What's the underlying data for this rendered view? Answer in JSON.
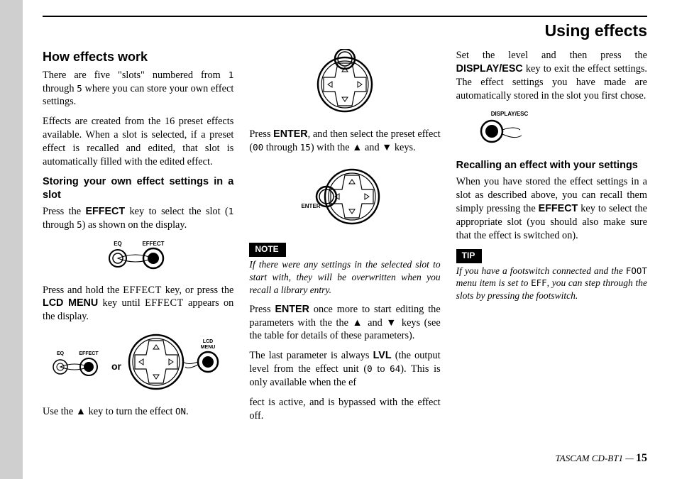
{
  "page_title": "Using effects",
  "section_heading": "How effects work",
  "p1a": "There are five \"slots\" numbered from ",
  "p1b": " through ",
  "p1c": " where you can store your own effect settings.",
  "slot_from": "1",
  "slot_to": "5",
  "p2": "Effects are created from the 16 preset effects available. When a slot is selected, if a preset effect is recalled and edited, that slot is automatically filled with the edited effect.",
  "subhead1": "Storing your own effect settings in a slot",
  "p3a": "Press the ",
  "effect_key": "EFFECT",
  "p3b": " key to select the slot (",
  "p3c": " through ",
  "p3d": ") as shown on the display.",
  "p4a": "Press and hold the ",
  "effect_sc": "EFFECT",
  "p4b": " key, or press the ",
  "lcd_menu": "LCD MENU",
  "p4c": " key until ",
  "p4d": " appears on the display.",
  "or": "or",
  "p5a": "Use the ",
  "p5b": " key to turn the effect ",
  "on": "ON",
  "p5c": ".",
  "p6a": "Press ",
  "enter_key": "ENTER",
  "p6b": ", and then select the preset effect (",
  "preset_from": "00",
  "p6c": " through ",
  "preset_to": "15",
  "p6d": ") with the ",
  "p6e": " and ",
  "p6f": " keys.",
  "note_label": "NOTE",
  "note_text": "If there were any settings in the selected slot to start with, they will be overwritten when you recall a library entry.",
  "p7a": "Press ",
  "p7b": " once more to start editing the parameters with the the ",
  "p7c": " and ",
  "p7d": " keys (see the table for details of these parameters).",
  "p8a": "The last parameter is always ",
  "lvl": "LVL",
  "p8b": " (the output level from the effect unit (",
  "lvl_from": "0",
  "p8c": " to ",
  "lvl_to": "64",
  "p8d": "). This is only available when the ef",
  "p8e": "fect is active, and is bypassed with the effect off.",
  "p9a": "Set the level and then press the ",
  "display_esc": "DISPLAY/ESC",
  "p9b": " key to exit the effect settings. The effect settings you have made are automatically stored in the slot you first chose.",
  "subhead2": "Recalling an effect with your settings",
  "p10a": "When you have stored the effect settings in a slot as described above, you can recall them simply pressing the ",
  "p10b": " key to select the appropriate slot (you should also make sure that the effect is switched on).",
  "tip_label": "TIP",
  "tip_text_a": "If you have a footswitch connected and the ",
  "foot": "FOOT",
  "tip_text_b": " menu item is set to ",
  "eff": "EFF",
  "tip_text_c": ", you can step through the slots by pressing the footswitch.",
  "footer_product": "TASCAM CD-BT1 — ",
  "footer_page": "15",
  "icon_eq": "EQ",
  "icon_effect": "EFFECT",
  "icon_lcd_menu": "LCD MENU",
  "icon_enter": "ENTER",
  "icon_display_esc": "DISPLAY/ESC"
}
